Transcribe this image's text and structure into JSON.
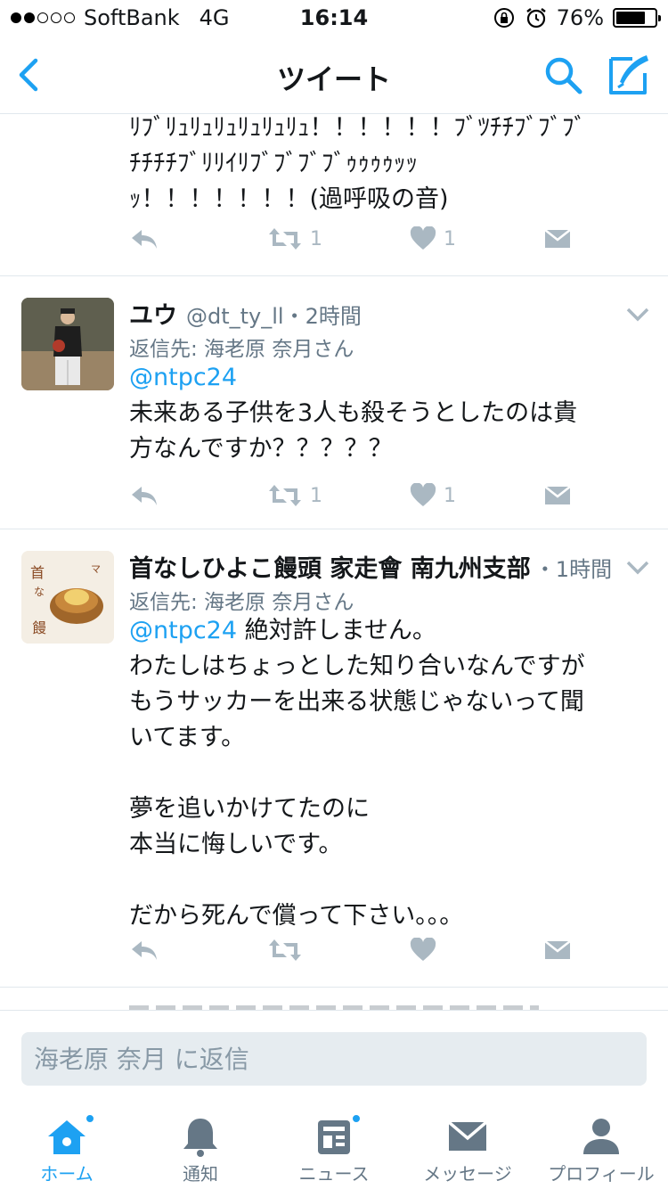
{
  "status_bar": {
    "carrier": "SoftBank",
    "network": "4G",
    "time": "16:14",
    "battery_percent": "76%",
    "battery_level": 0.76,
    "signal_bars": 2
  },
  "nav": {
    "title": "ツイート",
    "back_icon": "chevron-left-icon",
    "search_icon": "search-icon",
    "compose_icon": "compose-icon"
  },
  "tweets": [
    {
      "text": "ﾘﾌﾞﾘｭﾘｭﾘｭﾘｭﾘｭﾘｭ！！！！！！ﾌﾞﾂﾁﾁﾌﾞﾌﾞﾌﾞ\nﾁﾁﾁﾁﾌﾞﾘﾘｲﾘﾌﾞﾌﾞﾌﾞﾌﾞｩｩｩｩｯｯ\nｯ！！！！！！！(過呼吸の音)",
      "retweets": "1",
      "likes": "1"
    },
    {
      "name": "ユウ",
      "handle_time": "@dt_ty_ll・2時間",
      "reply_to": "返信先: 海老原 奈月さん",
      "mention": "@ntpc24",
      "text": "未来ある子供を3人も殺そうとしたのは貴\n方なんですか？？？？？",
      "retweets": "1",
      "likes": "1"
    },
    {
      "name": "首なしひよこ饅頭 家走會 南九州支部",
      "handle_time": "・1時間",
      "reply_to": "返信先: 海老原 奈月さん",
      "mention": "@ntpc24",
      "text_first": " 絶対許しません。",
      "text": "わたしはちょっとした知り合いなんですが\nもうサッカーを出来る状態じゃないって聞\nいてます。\n\n夢を追いかけてたのに\n本当に悔しいです。\n\nだから死んで償って下さい。。。",
      "avatar_text": "首なしひよこ饅頭",
      "avatar_sub": "マック"
    }
  ],
  "reply_bar": {
    "placeholder": "海老原 奈月 に返信"
  },
  "tabs": [
    {
      "label": "ホーム",
      "icon": "home-icon",
      "active": true
    },
    {
      "label": "通知",
      "icon": "bell-icon"
    },
    {
      "label": "ニュース",
      "icon": "news-icon"
    },
    {
      "label": "メッセージ",
      "icon": "envelope-icon"
    },
    {
      "label": "プロフィール",
      "icon": "person-icon"
    }
  ],
  "colors": {
    "accent": "#1da1f2",
    "text": "#14171a",
    "secondary": "#657786",
    "action_gray": "#aab8c2",
    "divider": "#e1e8ed"
  }
}
